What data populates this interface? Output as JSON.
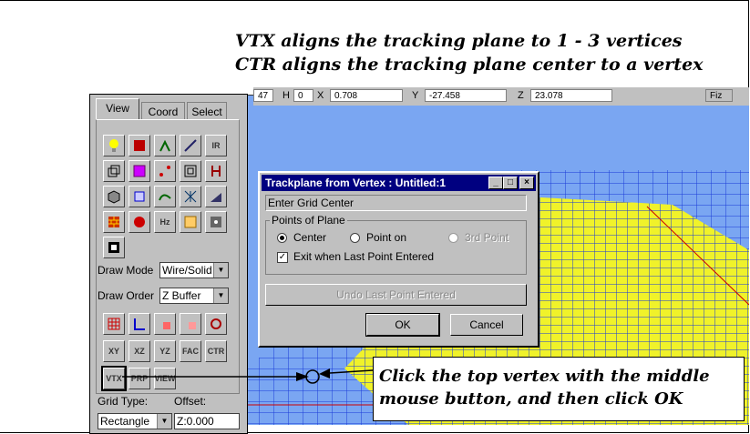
{
  "caption": {
    "line1": "VTX aligns the tracking plane to 1 - 3 vertices",
    "line2": "CTR aligns the tracking plane center to a vertex"
  },
  "coordbar": {
    "v_field": "47",
    "h_label": "H",
    "h_field": "0",
    "x_label": "X",
    "x_value": "0.708",
    "y_label": "Y",
    "y_value": "-27.458",
    "z_label": "Z",
    "z_value": "23.078",
    "fiz_label": "Fiz"
  },
  "panel": {
    "tabs": [
      "View",
      "Coord",
      "Select"
    ],
    "icons_row1": [
      "light-icon",
      "cube-sphere-icon",
      "axis-icon",
      "line-icon",
      "ir-icon"
    ],
    "icons_row2": [
      "wire-box-icon",
      "select-box-icon",
      "points-icon",
      "double-box-icon",
      "bracket-icon"
    ],
    "icons_row3": [
      "solid-box-icon",
      "corner-box-icon",
      "curve-icon",
      "mesh-icon",
      "sweep-icon"
    ],
    "icons_row4": [
      "brick-icon",
      "sphere-icon",
      "hz-icon",
      "texture-icon",
      "dice-icon"
    ],
    "ir_label": "IR",
    "hz_label": "Hz",
    "draw_mode_label": "Draw Mode",
    "draw_mode_value": "Wire/Solid",
    "draw_order_label": "Draw Order",
    "draw_order_value": "Z Buffer",
    "plane_buttons": [
      "XY",
      "XZ",
      "YZ",
      "FAC",
      "CTR"
    ],
    "plane_buttons2": [
      "VTX",
      "PRP",
      "VIEW"
    ],
    "grid_type_label": "Grid Type:",
    "offset_label": "Offset:",
    "grid_type_value": "Rectangle",
    "offset_value": "Z:0.000"
  },
  "dialog": {
    "title": "Trackplane from Vertex : Untitled:1",
    "status": "Enter Grid Center",
    "group_label": "Points of Plane",
    "radio_center": "Center",
    "radio_pointon": "Point on",
    "radio_third": "3rd Point",
    "checkbox_label": "Exit when Last Point Entered",
    "undo_button": "Undo Last Point Entered",
    "ok_button": "OK",
    "cancel_button": "Cancel"
  },
  "callout": {
    "line1": "Click the top vertex with the middle",
    "line2": "mouse button, and then click OK"
  }
}
